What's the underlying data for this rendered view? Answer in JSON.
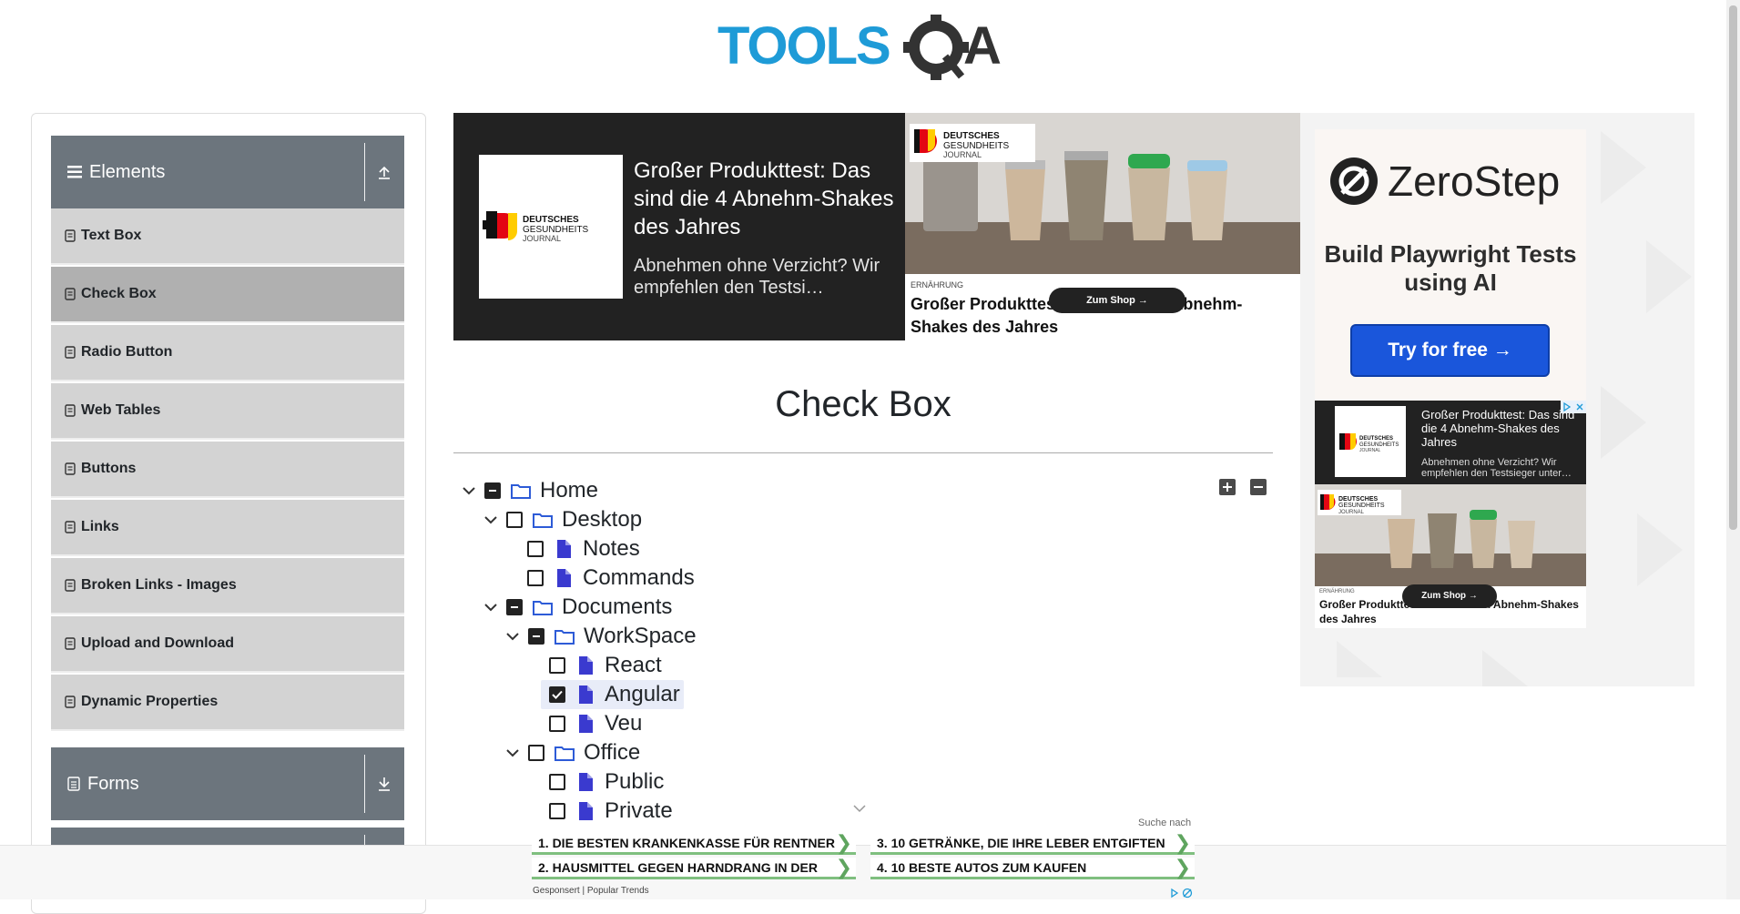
{
  "header": {
    "logo_text": "TOOLSQA"
  },
  "sidebar": {
    "groups": [
      {
        "label": "Elements"
      },
      {
        "label": "Forms"
      }
    ],
    "items": [
      {
        "label": "Text Box"
      },
      {
        "label": "Check Box"
      },
      {
        "label": "Radio Button"
      },
      {
        "label": "Web Tables"
      },
      {
        "label": "Buttons"
      },
      {
        "label": "Links"
      },
      {
        "label": "Broken Links - Images"
      },
      {
        "label": "Upload and Download"
      },
      {
        "label": "Dynamic Properties"
      }
    ]
  },
  "banner_ad": {
    "logo_line1": "DEUTSCHES",
    "logo_line2": "GESUNDHEITS",
    "logo_line3": "JOURNAL",
    "title": "Großer Produkttest: Das sind die 4 Abnehm-Shakes des Jahres",
    "description": "Abnehmen ohne Verzicht? Wir empfehlen den Testsi…",
    "category": "ERNÄHRUNG",
    "headline": "Großer Produkttest: Die 4 besten Abnehm-Shakes des Jahres",
    "cta": "Zum Shop →"
  },
  "right_ad": {
    "brand": "ZeroStep",
    "tagline": "Build Playwright Tests using AI",
    "cta": "Try for free →",
    "mini": {
      "title": "Großer Produkttest: Das sind die 4 Abnehm-Shakes des Jahres",
      "description": "Abnehmen ohne Verzicht? Wir empfehlen den Testsieger unter…",
      "category": "ERNÄHRUNG",
      "headline": "Großer Produkttest: Die 4 besten Abnehm-Shakes des Jahres",
      "cta": "Zum Shop →"
    }
  },
  "main": {
    "title": "Check Box",
    "tree": [
      {
        "label": "Home",
        "state": "partial",
        "type": "folder",
        "expanded": true
      },
      {
        "label": "Desktop",
        "state": "unchecked",
        "type": "folder",
        "expanded": true
      },
      {
        "label": "Notes",
        "state": "unchecked",
        "type": "file"
      },
      {
        "label": "Commands",
        "state": "unchecked",
        "type": "file"
      },
      {
        "label": "Documents",
        "state": "partial",
        "type": "folder",
        "expanded": true
      },
      {
        "label": "WorkSpace",
        "state": "partial",
        "type": "folder",
        "expanded": true
      },
      {
        "label": "React",
        "state": "unchecked",
        "type": "file"
      },
      {
        "label": "Angular",
        "state": "checked",
        "type": "file"
      },
      {
        "label": "Veu",
        "state": "unchecked",
        "type": "file"
      },
      {
        "label": "Office",
        "state": "unchecked",
        "type": "folder",
        "expanded": true
      },
      {
        "label": "Public",
        "state": "unchecked",
        "type": "file"
      },
      {
        "label": "Private",
        "state": "unchecked",
        "type": "file"
      }
    ]
  },
  "bottom_ad": {
    "search_note": "Suche nach",
    "links": [
      "1. DIE BESTEN KRANKENKASSE FÜR RENTNER",
      "2. HAUSMITTEL GEGEN HARNDRANG IN DER",
      "3. 10 GETRÄNKE, DIE IHRE LEBER ENTGIFTEN",
      "4. 10 BESTE AUTOS ZUM KAUFEN"
    ],
    "sponsor": "Gesponsert | Popular Trends"
  },
  "colors": {
    "sidebar_header": "#6c757d",
    "sidebar_item": "#d3d3d3",
    "sidebar_active": "#b0b0b0",
    "brand_blue": "#1e9bd7",
    "file_icon": "#3a3acf",
    "cta_blue": "#1a56db"
  }
}
